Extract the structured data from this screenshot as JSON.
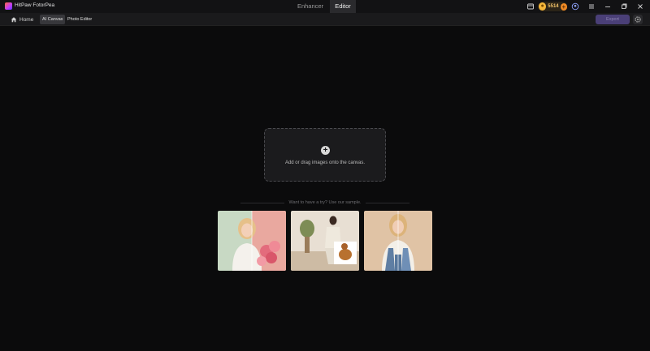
{
  "app": {
    "title": "HitPaw FotorPea"
  },
  "modes": [
    {
      "label": "Enhancer"
    },
    {
      "label": "Editor"
    }
  ],
  "titlebar": {
    "coins": "5514"
  },
  "toolbar": {
    "home_label": "Home",
    "tabs": [
      {
        "label": "AI Canvas"
      },
      {
        "label": "Photo Editor"
      }
    ],
    "export_label": "Export"
  },
  "canvas": {
    "dropzone_text": "Add or drag images onto the canvas.",
    "sample_prompt": "Want to have a try? Use our sample."
  },
  "colors": {
    "accent": "#4a3f77",
    "coin": "#f4b63a",
    "background": "#0b0b0c"
  },
  "icons": [
    "app-logo-icon",
    "gift-icon",
    "coin-icon",
    "add-coin-icon",
    "account-icon",
    "menu-icon",
    "minimize-icon",
    "restore-icon",
    "close-icon",
    "home-icon",
    "gear-icon",
    "plus-icon"
  ]
}
